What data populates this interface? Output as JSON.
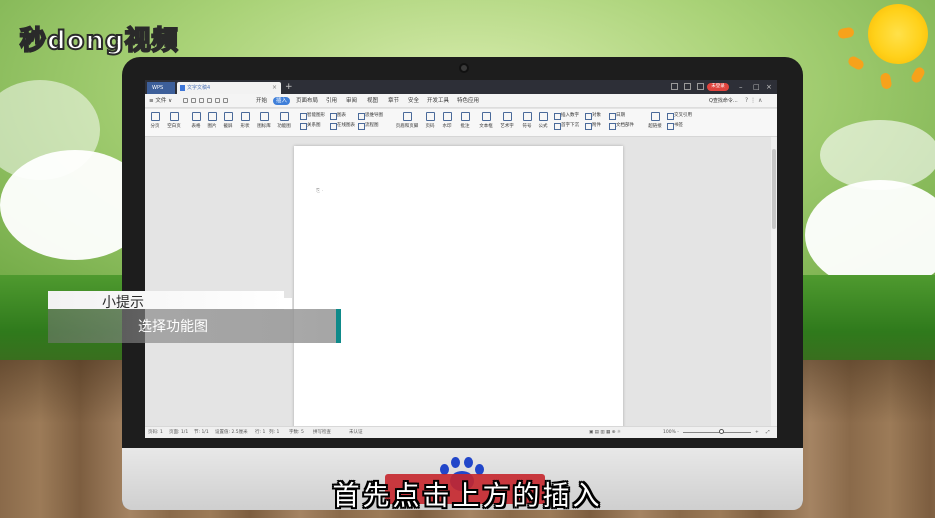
{
  "brand": {
    "logo_text": "秒dong视频",
    "colors": {
      "accent": "#3f7fd9",
      "tip_accent": "#0f8a8a",
      "login": "#e0443e"
    }
  },
  "window": {
    "wps_tab": "WPS",
    "doc_tab": "文字文稿4",
    "close_glyph": "×",
    "add_tab_glyph": "+",
    "login_label": "未登录"
  },
  "menubar": {
    "file_label": "≡ 文件 ∨",
    "items": [
      "开始",
      "插入",
      "页面布局",
      "引用",
      "审阅",
      "视图",
      "章节",
      "安全",
      "开发工具",
      "特色应用"
    ],
    "active_index": 1,
    "search_label": "Q查找命令..."
  },
  "ribbon": {
    "large": [
      "分页",
      "空白页",
      "表格",
      "图片",
      "截屏",
      "形状",
      "图标库",
      "功能图",
      "页眉和页脚",
      "页码",
      "水印",
      "批注",
      "文本框",
      "艺术字",
      "符号",
      "公式",
      "超链接",
      "书签"
    ],
    "small": [
      "智能图形",
      "图表",
      "思维导图",
      "关系图",
      "在线图表",
      "流程图",
      "插入数字",
      "对象",
      "日期",
      "首字下沉",
      "附件",
      "文档部件",
      "交叉引用"
    ]
  },
  "status": {
    "page_no": "页码: 1",
    "pages": "页面: 1/1",
    "section": "节: 1/1",
    "position": "设置值: 2.5厘米",
    "row": "行: 1",
    "col": "列: 1",
    "words": "字数: 5",
    "spell": "拼写检查",
    "doc_check": "未认证",
    "zoom": "100% -"
  },
  "tip": {
    "title": "小提示",
    "body": "选择功能图"
  },
  "subtitle": "首先点击上方的插入"
}
